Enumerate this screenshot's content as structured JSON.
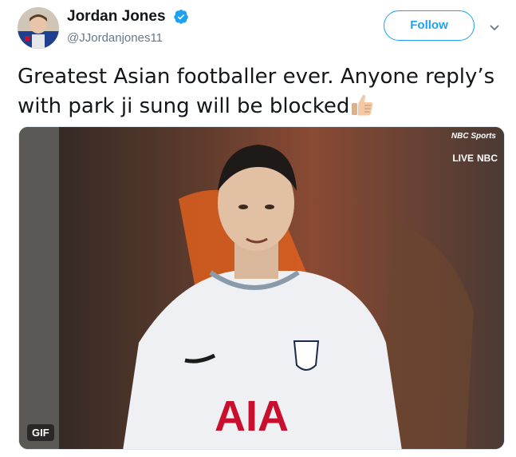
{
  "author": {
    "display_name": "Jordan Jones",
    "handle": "@JJordanjones11",
    "verified": true
  },
  "follow_button": {
    "label": "Follow"
  },
  "tweet": {
    "text": "Greatest Asian footballer ever. Anyone reply’s with park ji sung will be blocked",
    "emoji_icon": "thumbs-up-icon"
  },
  "media": {
    "type": "gif",
    "badge": "GIF",
    "broadcast_bug": {
      "top": "NBC Sports",
      "live": "LIVE",
      "network": "NBC"
    },
    "jersey_sponsor": "AIA"
  },
  "colors": {
    "accent": "#1da1f2",
    "text": "#14171a",
    "secondary": "#657786",
    "border": "#e1e8ed"
  }
}
